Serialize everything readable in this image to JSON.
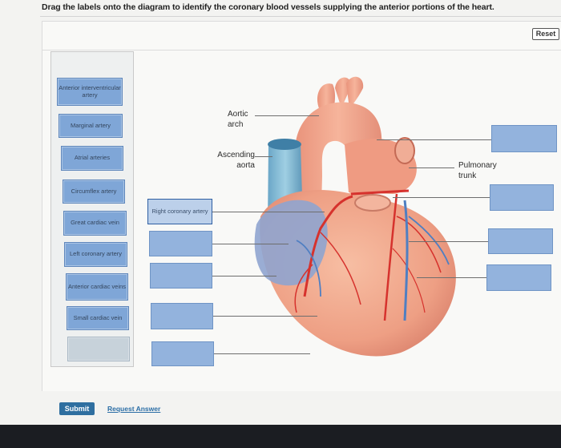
{
  "question": "Drag the labels onto the diagram to identify the coronary blood vessels supplying the anterior portions of the heart.",
  "reset_label": "Reset",
  "label_bank": [
    "Anterior interventricular artery",
    "Marginal artery",
    "Atrial arteries",
    "Circumflex artery",
    "Great cardiac vein",
    "Left coronary artery",
    "Anterior cardiac veins",
    "Small cardiac vein",
    ""
  ],
  "placed_label": "Right coronary artery",
  "diagram_labels": {
    "aortic_arch": "Aortic arch",
    "ascending_aorta": "Ascending aorta",
    "pulmonary_trunk": "Pulmonary trunk"
  },
  "submit_label": "Submit",
  "request_answer_label": "Request Answer",
  "colors": {
    "chip": "#7fa6d7",
    "target": "#93b3dd",
    "submit": "#2f6fa0",
    "heart": "#f0a48a",
    "artery": "#d6322d",
    "vein": "#4f7fc2"
  }
}
